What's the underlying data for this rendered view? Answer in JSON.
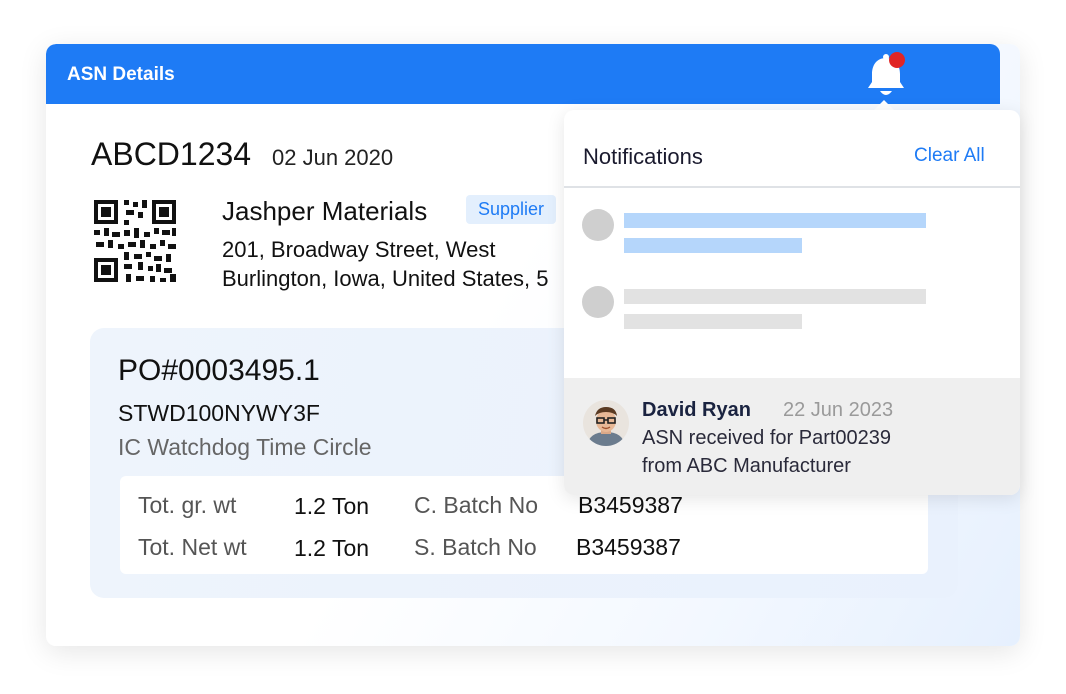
{
  "header": {
    "title": "ASN Details",
    "icon": "bell-icon",
    "accent": "#1e7bf5",
    "alert_color": "#e02525"
  },
  "asn": {
    "id": "ABCD1234",
    "date": "02 Jun 2020"
  },
  "supplier": {
    "name": "Jashper Materials",
    "badge": "Supplier",
    "address_line1": "201, Broadway Street, West",
    "address_line2": "Burlington, Iowa, United States, 5"
  },
  "po": {
    "number": "PO#0003495.1",
    "code": "STWD100NYWY3F",
    "description": "IC Watchdog Time Circle",
    "rows": [
      {
        "label1": "Tot. gr. wt",
        "value1": "1.2 Ton",
        "label2": "C. Batch No",
        "value2": "B3459387"
      },
      {
        "label1": "Tot. Net wt",
        "value1": "1.2 Ton",
        "label2": "S. Batch No",
        "value2": "B3459387"
      }
    ]
  },
  "notifications": {
    "title": "Notifications",
    "clear_label": "Clear All",
    "item": {
      "name": "David Ryan",
      "date": "22 Jun 2023",
      "message_line1": "ASN received for Part00239",
      "message_line2": "from ABC Manufacturer"
    }
  }
}
